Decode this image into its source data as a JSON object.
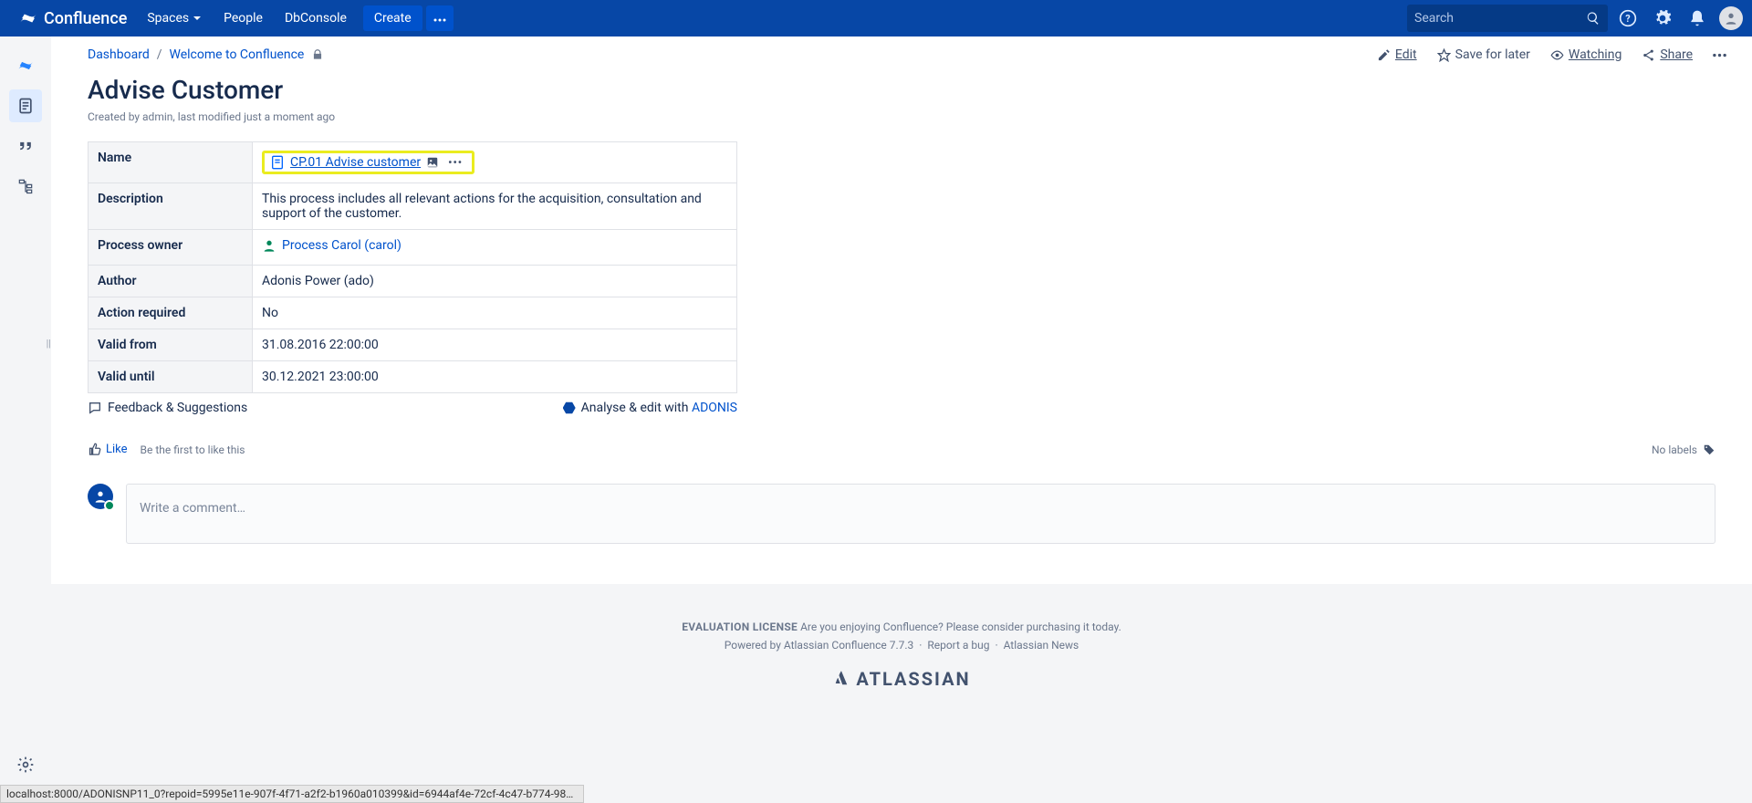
{
  "nav": {
    "brand": "Confluence",
    "spaces": "Spaces",
    "people": "People",
    "dbconsole": "DbConsole",
    "create": "Create",
    "search_placeholder": "Search"
  },
  "breadcrumbs": {
    "dashboard": "Dashboard",
    "welcome": "Welcome to Confluence"
  },
  "page_actions": {
    "edit": "Edit",
    "save": "Save for later",
    "watching": "Watching",
    "share": "Share"
  },
  "page": {
    "title": "Advise Customer",
    "meta": "Created by admin, last modified just a moment ago"
  },
  "table": {
    "name_label": "Name",
    "name_link": "CP.01 Advise customer",
    "description_label": "Description",
    "description_value": "This process includes all relevant actions for the acquisition, consultation and support of the customer.",
    "owner_label": "Process owner",
    "owner_value": "Process Carol (carol)",
    "author_label": "Author",
    "author_value": "Adonis Power (ado)",
    "action_label": "Action required",
    "action_value": "No",
    "valid_from_label": "Valid from",
    "valid_from_value": "31.08.2016 22:00:00",
    "valid_until_label": "Valid until",
    "valid_until_value": "30.12.2021 23:00:00"
  },
  "below": {
    "feedback": "Feedback & Suggestions",
    "adonis_prefix": "Analyse & edit with ",
    "adonis_link": "ADONIS"
  },
  "like": {
    "like": "Like",
    "be_first": "Be the first to like this",
    "no_labels": "No labels"
  },
  "comment": {
    "placeholder": "Write a comment…"
  },
  "footer": {
    "eval": "EVALUATION LICENSE",
    "eval_text": " Are you enjoying Confluence? Please consider purchasing it today.",
    "powered": "Powered by ",
    "atlassian_conf": "Atlassian Confluence",
    "version": " 7.7.3",
    "report": "Report a bug",
    "news": "Atlassian News",
    "logo": "ATLASSIAN"
  },
  "status": "localhost:8000/ADONISNP11_0?repoid=5995e11e-907f-4f71-a2f2-b1960a010399&id=6944af4e-72cf-4c47-b774-982…"
}
